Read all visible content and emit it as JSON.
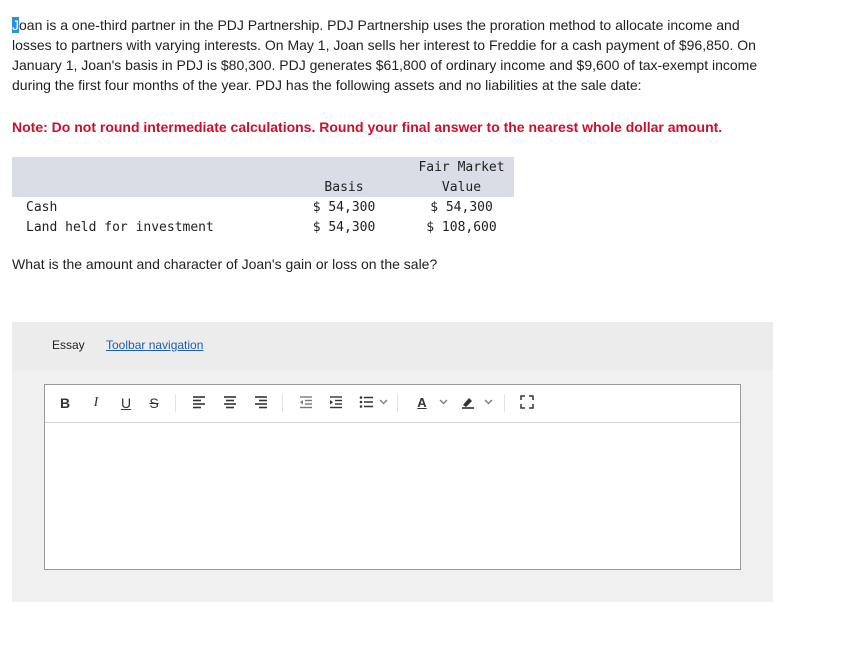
{
  "problem": {
    "first_letter": "J",
    "text": "oan is a one-third partner in the PDJ Partnership. PDJ Partnership uses the proration method to allocate income and losses to partners with varying interests. On May 1, Joan sells her interest to Freddie for a cash payment of $96,850. On January 1, Joan's basis in PDJ is $80,300. PDJ generates $61,800 of ordinary income and $9,600 of tax-exempt income during the first four months of the year. PDJ has the following assets and no liabilities at the sale date:",
    "note": "Note: Do not round intermediate calculations. Round your final answer to the nearest whole dollar amount."
  },
  "assets_table": {
    "header_fmv_line1": "Fair Market",
    "header_basis": "Basis",
    "header_fmv_line2": "Value",
    "rows": [
      {
        "label": "Cash",
        "basis": "$ 54,300",
        "fmv": "$ 54,300"
      },
      {
        "label": "Land held for investment",
        "basis": "$ 54,300",
        "fmv": "$ 108,600"
      }
    ]
  },
  "question": "What is the amount and character of Joan's gain or loss on the sale?",
  "essay": {
    "label": "Essay",
    "toolbar_nav_link": "Toolbar navigation",
    "toolbar": {
      "bold": "B",
      "italic": "I",
      "underline": "U",
      "strikethrough": "S",
      "font_color": "A"
    },
    "content": ""
  }
}
